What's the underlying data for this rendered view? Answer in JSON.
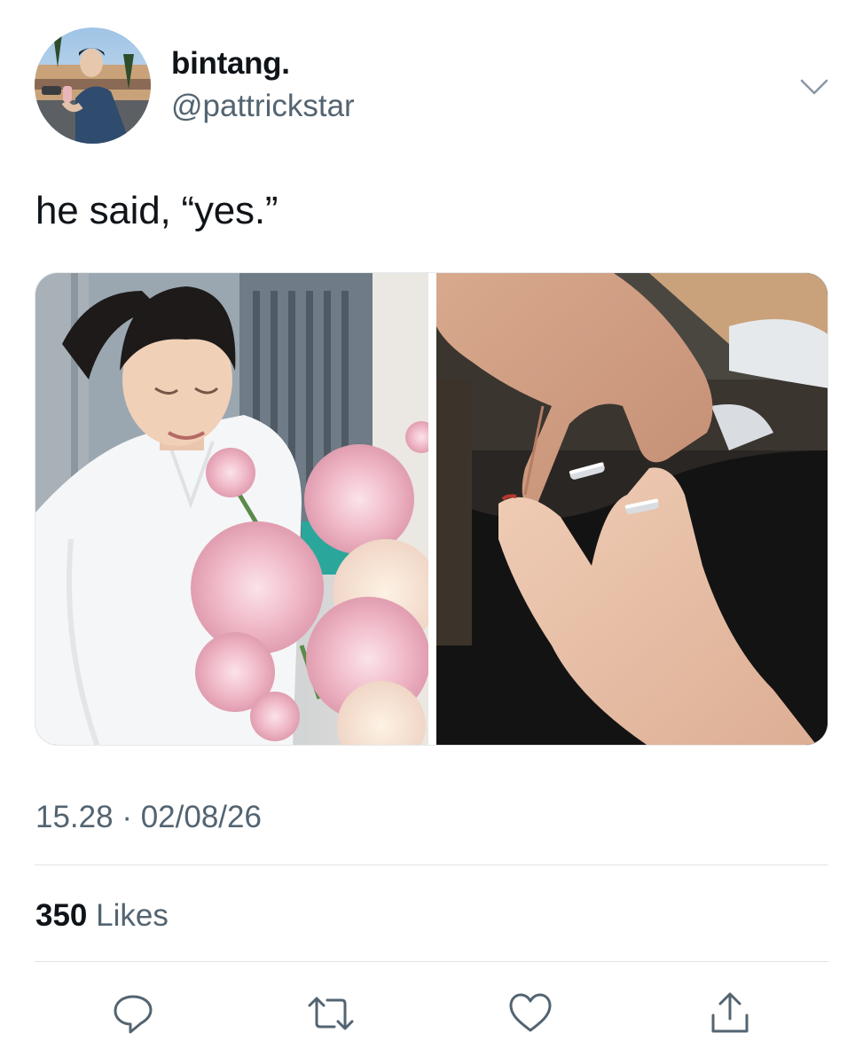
{
  "author": {
    "display_name": "bintang.",
    "handle": "@pattrickstar"
  },
  "tweet": {
    "text": "he said, “yes.”"
  },
  "meta": {
    "time": "15.28",
    "separator": " · ",
    "date": "02/08/26"
  },
  "stats": {
    "likes_count": "350",
    "likes_label": " Likes"
  },
  "icons": {
    "more": "chevron-down-icon",
    "reply": "reply-icon",
    "retweet": "retweet-icon",
    "like": "heart-icon",
    "share": "share-icon"
  },
  "colors": {
    "text_primary": "#0f1419",
    "text_secondary": "#536471",
    "divider": "#dfe3e6",
    "icon": "#536471"
  }
}
